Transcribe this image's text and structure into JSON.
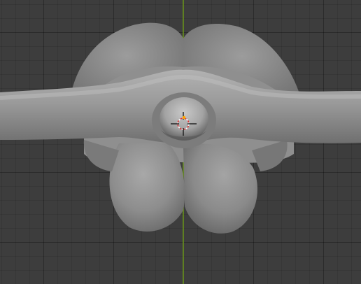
{
  "viewport": {
    "background_color": "#3d3d3d",
    "grid_color": "#2f2f2f",
    "axis_color": "#6e9a1c",
    "mesh_color": "#8a8a8a"
  },
  "objects": [
    {
      "name": "sculpt-mesh"
    },
    {
      "name": "3d-cursor"
    },
    {
      "name": "origin-point"
    }
  ],
  "icons": {
    "cursor": "3d-cursor-icon",
    "origin": "origin-dot-icon"
  }
}
